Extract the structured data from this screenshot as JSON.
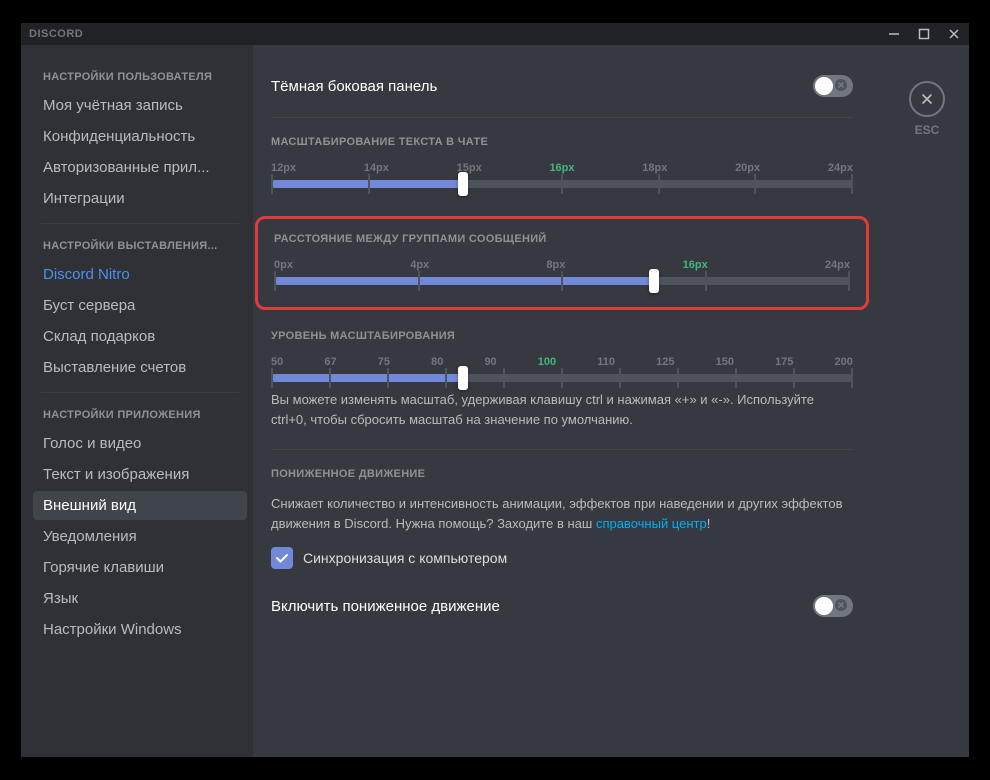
{
  "titlebar": {
    "brand": "DISCORD"
  },
  "esc": {
    "label": "ESC"
  },
  "sidebar": {
    "headers": {
      "user": "НАСТРОЙКИ ПОЛЬЗОВАТЕЛЯ",
      "billing": "НАСТРОЙКИ ВЫСТАВЛЕНИЯ...",
      "app": "НАСТРОЙКИ ПРИЛОЖЕНИЯ"
    },
    "items": {
      "account": "Моя учётная запись",
      "privacy": "Конфиденциальность",
      "authorized": "Авторизованные прил...",
      "integrations": "Интеграции",
      "nitro": "Discord Nitro",
      "boost": "Буст сервера",
      "gifts": "Склад подарков",
      "billing": "Выставление счетов",
      "voice": "Голос и видео",
      "text": "Текст и изображения",
      "appearance": "Внешний вид",
      "notifications": "Уведомления",
      "keybinds": "Горячие клавиши",
      "language": "Язык",
      "windows": "Настройки Windows"
    }
  },
  "settings": {
    "darkSidebar": {
      "title": "Тёмная боковая панель"
    },
    "chatScaling": {
      "label": "МАСШТАБИРОВАНИЕ ТЕКСТА В ЧАТЕ",
      "ticks": [
        "12px",
        "14px",
        "15px",
        "16px",
        "18px",
        "20px",
        "24px"
      ],
      "currentIndex": 3,
      "fillPercent": 33
    },
    "messageSpacing": {
      "label": "РАССТОЯНИЕ МЕЖДУ ГРУППАМИ СООБЩЕНИЙ",
      "ticks": [
        "0px",
        "4px",
        "8px",
        "16px",
        "24px"
      ],
      "currentIndex": 3,
      "fillPercent": 66
    },
    "zoom": {
      "label": "УРОВЕНЬ МАСШТАБИРОВАНИЯ",
      "ticks": [
        "50",
        "67",
        "75",
        "80",
        "90",
        "100",
        "110",
        "125",
        "150",
        "175",
        "200"
      ],
      "currentIndex": 5,
      "fillPercent": 33,
      "help": "Вы можете изменять масштаб, удерживая клавишу ctrl и нажимая «+» и «-». Используйте ctrl+0, чтобы сбросить масштаб на значение по умолчанию."
    },
    "reducedMotion": {
      "label": "ПОНИЖЕННОЕ ДВИЖЕНИЕ",
      "descPrefix": "Снижает количество и интенсивность анимации, эффектов при наведении и других эффектов движения в Discord. Нужна помощь? Заходите в наш ",
      "linkText": "справочный центр",
      "descSuffix": "!",
      "syncLabel": "Синхронизация с компьютером",
      "enableTitle": "Включить пониженное движение"
    }
  }
}
